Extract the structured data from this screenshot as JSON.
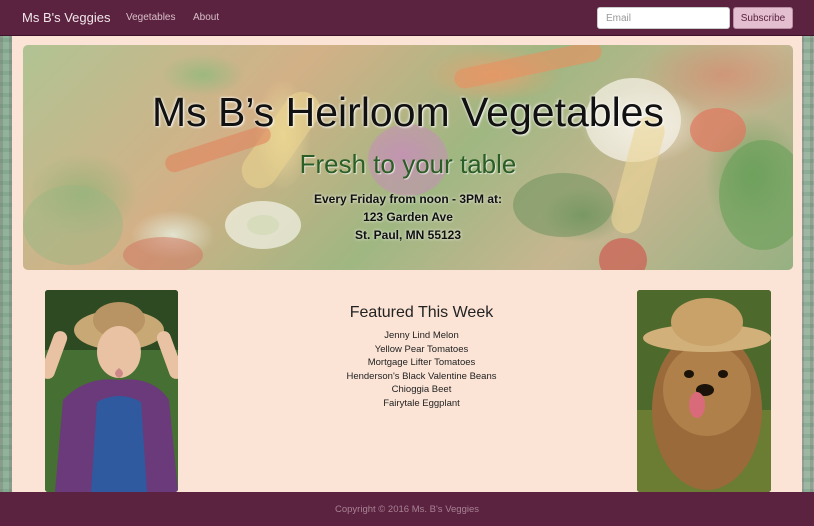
{
  "navbar": {
    "brand": "Ms B's Veggies",
    "links": [
      "Vegetables",
      "About"
    ],
    "email_placeholder": "Email",
    "subscribe_label": "Subscribe"
  },
  "hero": {
    "title": "Ms B’s Heirloom Vegetables",
    "subtitle": "Fresh to your table",
    "schedule": "Every Friday from noon - 3PM at:",
    "address_line1": "123 Garden Ave",
    "address_line2": "St. Paul, MN 55123"
  },
  "featured": {
    "title": "Featured This Week",
    "items": [
      "Jenny Lind Melon",
      "Yellow Pear Tomatoes",
      "Mortgage Lifter Tomatoes",
      "Henderson's Black Valentine Beans",
      "Chioggia Beet",
      "Fairytale Eggplant"
    ]
  },
  "footer": {
    "copyright": "Copyright © 2016 Ms. B's Veggies"
  },
  "colors": {
    "navbar": "#5b2340",
    "page_panel": "#fbe4d6",
    "subscribe_button": "#e3bfd0",
    "subtitle_green": "#2a5e26"
  }
}
